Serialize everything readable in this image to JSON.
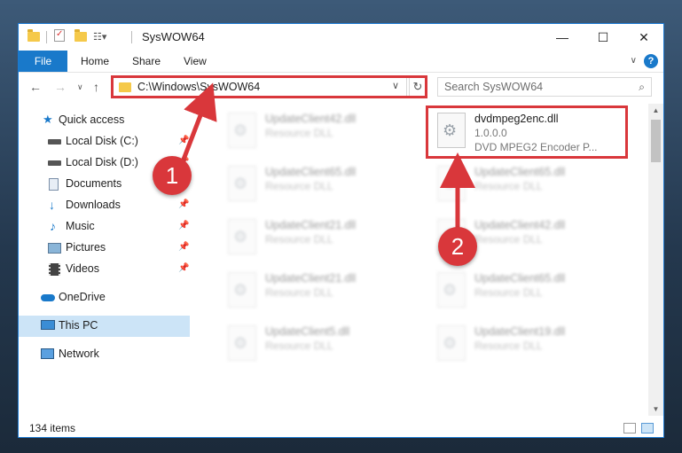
{
  "window": {
    "title": "SysWOW64",
    "controls": {
      "minimize": "—",
      "maximize": "☐",
      "close": "✕"
    }
  },
  "ribbon": {
    "tabs": [
      "File",
      "Home",
      "Share",
      "View"
    ],
    "help": "?"
  },
  "navigation": {
    "address": "C:\\Windows\\SysWOW64",
    "search_placeholder": "Search SysWOW64"
  },
  "sidebar": {
    "items": [
      {
        "label": "Quick access",
        "icon": "star-icon"
      },
      {
        "label": "Local Disk (C:)",
        "icon": "drive-icon"
      },
      {
        "label": "Local Disk (D:)",
        "icon": "drive-icon"
      },
      {
        "label": "Documents",
        "icon": "documents-icon"
      },
      {
        "label": "Downloads",
        "icon": "download-icon"
      },
      {
        "label": "Music",
        "icon": "music-icon"
      },
      {
        "label": "Pictures",
        "icon": "pictures-icon"
      },
      {
        "label": "Videos",
        "icon": "videos-icon"
      },
      {
        "label": "OneDrive",
        "icon": "cloud-icon"
      },
      {
        "label": "This PC",
        "icon": "computer-icon"
      },
      {
        "label": "Network",
        "icon": "network-icon"
      }
    ]
  },
  "files": [
    {
      "name": "UpdateClient42.dll",
      "type": "Resource DLL"
    },
    {
      "name": "dvdmpeg2enc.dll",
      "version": "1.0.0.0",
      "description": "DVD MPEG2 Encoder P..."
    },
    {
      "name": "UpdateClient65.dll",
      "type": "Resource DLL"
    },
    {
      "name": "UpdateClient65.dll",
      "type": "Resource DLL"
    },
    {
      "name": "UpdateClient21.dll",
      "type": "Resource DLL"
    },
    {
      "name": "UpdateClient42.dll",
      "type": "Resource DLL"
    },
    {
      "name": "UpdateClient21.dll",
      "type": "Resource DLL"
    },
    {
      "name": "UpdateClient65.dll",
      "type": "Resource DLL"
    },
    {
      "name": "UpdateClient5.dll",
      "type": "Resource DLL"
    },
    {
      "name": "UpdateClient19.dll",
      "type": "Resource DLL"
    }
  ],
  "status": {
    "item_count": "134 items"
  },
  "annotations": {
    "marker1": "1",
    "marker2": "2",
    "color": "#d9373b"
  }
}
